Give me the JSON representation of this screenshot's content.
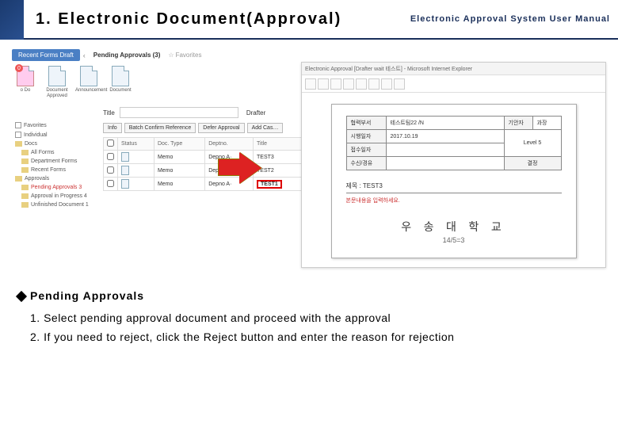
{
  "header": {
    "title": "1. Electronic Document(Approval)",
    "right": "Electronic Approval System User Manual"
  },
  "app": {
    "recent_btn": "Recent Forms Draft",
    "pending_label": "Pending Approvals (3)",
    "favorites": "Favorites",
    "icons": {
      "prog": "o Do",
      "doc1": "Document Approved",
      "doc2": "Announcement",
      "doc3": "Document"
    },
    "title_lbl": "Title",
    "drafter_lbl": "Drafter",
    "search_value": "",
    "toolbar": {
      "info": "Info",
      "batch": "Batch Confirm Reference",
      "defer": "Defer Approval",
      "addcas": "Add Cas…"
    },
    "table": {
      "headers": {
        "chk": "",
        "status": "Status",
        "doctype": "Doc. Type",
        "deptno": "Deptno.",
        "title": "Title"
      },
      "rows": [
        {
          "status": "",
          "doctype": "Memo",
          "deptno": "Depno A·",
          "title": "TEST3"
        },
        {
          "status": "",
          "doctype": "Memo",
          "deptno": "Depno A·",
          "title": "TEST2"
        },
        {
          "status": "",
          "doctype": "Memo",
          "deptno": "Depno A·",
          "title": "TEST1"
        }
      ]
    }
  },
  "sidebar": {
    "items": [
      {
        "label": "Favorites"
      },
      {
        "label": "Individual"
      },
      {
        "label": "Docs"
      },
      {
        "label": "All Forms"
      },
      {
        "label": "Department Forms"
      },
      {
        "label": "Recent Forms"
      },
      {
        "label": "Approvals"
      },
      {
        "label": "Pending Approvals 3",
        "red": true
      },
      {
        "label": "Approval in Progress 4"
      },
      {
        "label": "Unfinished Document 1"
      }
    ]
  },
  "preview": {
    "window_title": "Electronic Approval [Drafter wait 테스트] - Microsoft Internet Explorer",
    "form": {
      "r1c1_lbl": "협력부서",
      "r1c1_val": "테스트팀22 /N",
      "r1c2_lbl": "기안자",
      "r1c2_val": "과장",
      "r2c1_lbl": "시행일자",
      "r2c1_val": "2017.10.19",
      "r2c2_val": "Level 5",
      "r3c1_lbl": "접수일자",
      "r3c2_lbl": "결정",
      "r4c1_lbl": "수신/경유"
    },
    "doc_title_lbl": "제목 :",
    "doc_title_val": "TEST3",
    "note": "본문내용을 입력하세요.",
    "univ": "우 송 대 학 교",
    "slide": "14/5=3"
  },
  "instructions": {
    "heading": "Pending Approvals",
    "line1": "1. Select pending approval document and proceed with the approval",
    "line2": "2. If you need to reject, click the Reject button and enter the reason for rejection"
  }
}
